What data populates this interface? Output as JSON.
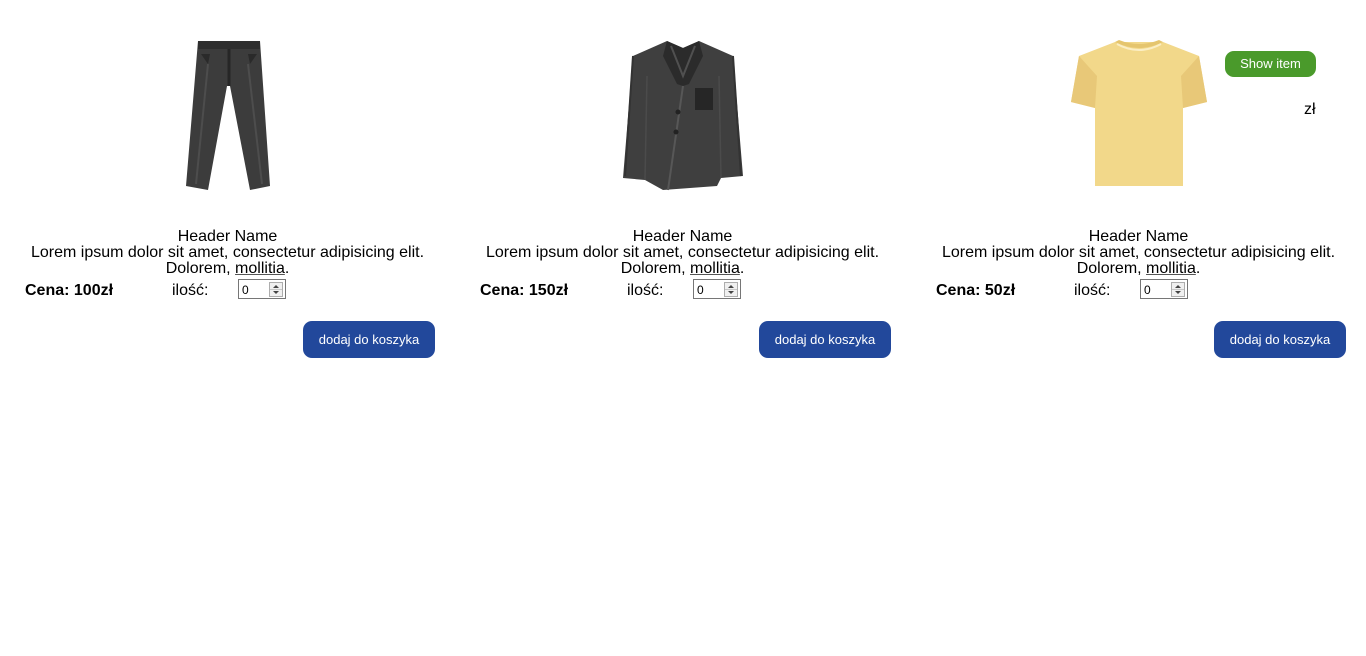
{
  "products": [
    {
      "icon": "trousers-icon",
      "header": "Header Name",
      "description_line1": "Lorem ipsum dolor sit amet, consectetur adipisicing elit.",
      "description_line2_a": "Dolorem, ",
      "description_line2_b": "mollitia",
      "description_line2_c": ".",
      "price": "Cena: 100zł",
      "quantity_label": "ilość:",
      "quantity_value": "0",
      "add_button": "dodaj do koszyka"
    },
    {
      "icon": "blazer-icon",
      "header": "Header Name",
      "description_line1": "Lorem ipsum dolor sit amet, consectetur adipisicing elit.",
      "description_line2_a": "Dolorem, ",
      "description_line2_b": "mollitia",
      "description_line2_c": ".",
      "price": "Cena: 150zł",
      "quantity_label": "ilość:",
      "quantity_value": "0",
      "add_button": "dodaj do koszyka"
    },
    {
      "icon": "tshirt-icon",
      "header": "Header Name",
      "description_line1": "Lorem ipsum dolor sit amet, consectetur adipisicing elit.",
      "description_line2_a": "Dolorem, ",
      "description_line2_b": "mollitia",
      "description_line2_c": ".",
      "price": "Cena: 50zł",
      "quantity_label": "ilość:",
      "quantity_value": "0",
      "add_button": "dodaj do koszyka"
    }
  ],
  "popup": {
    "show_button": "Show item",
    "currency": "zł"
  },
  "colors": {
    "add_button": "#22489b",
    "show_button": "#4a9a2b",
    "trousers": "#3c3c3c",
    "blazer": "#3f3f3f",
    "tshirt": "#f2d88a"
  }
}
